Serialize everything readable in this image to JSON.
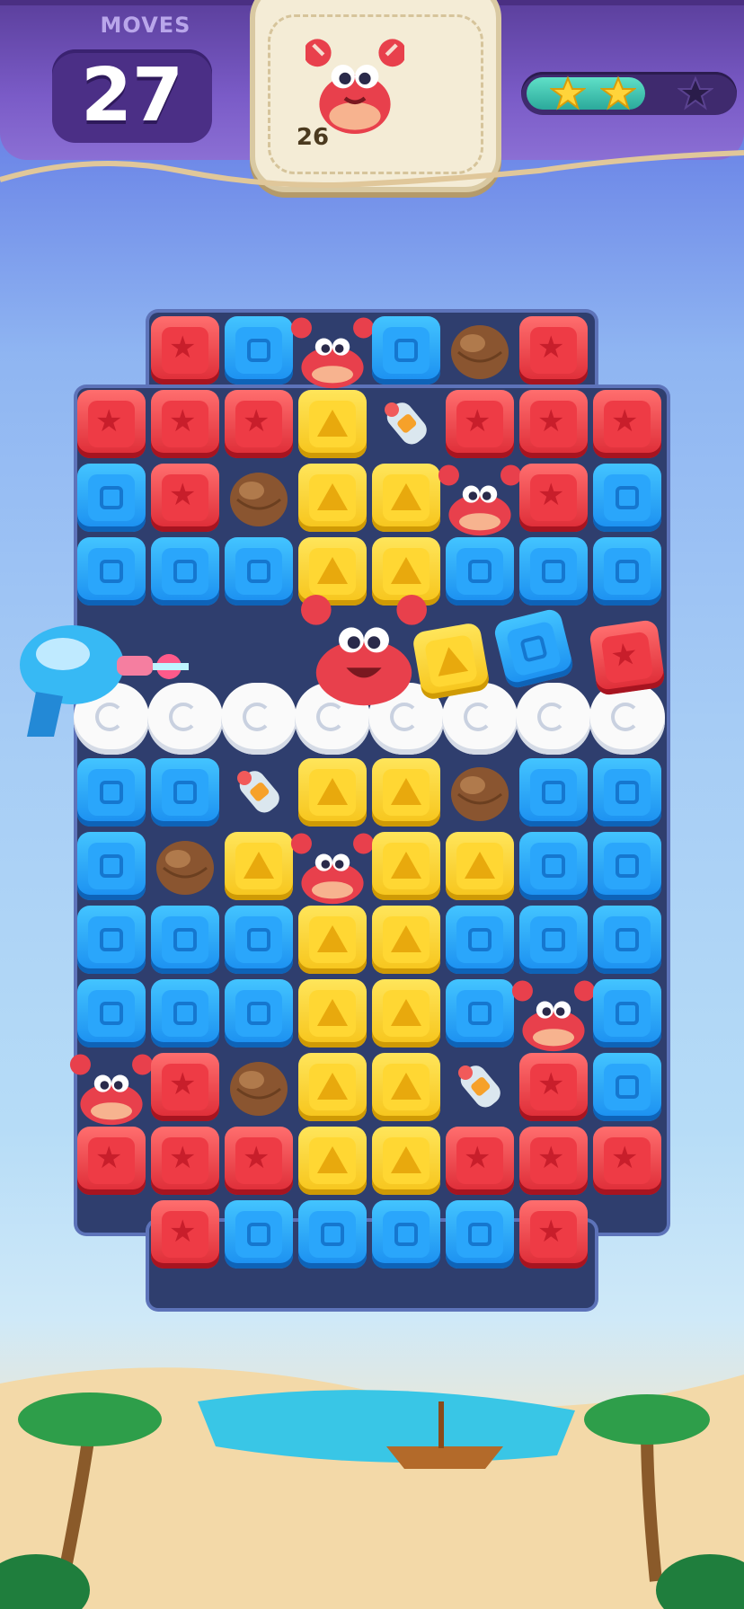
{
  "hud": {
    "moves_label": "MOVES",
    "moves_value": "27",
    "goal": {
      "icon": "crab-icon",
      "count": "26"
    },
    "stars": {
      "earned": 2,
      "total": 3,
      "progress": 0.58
    }
  },
  "board": {
    "rows": [
      "_RBCBNR_",
      "RRRYPRRR",
      "BRNYYCRB",
      "BBBYYBBB",
      "__._.___",
      "WWWWWWWW",
      "BBPYYNBB",
      "BNYCYYBB",
      "BBBYYBBB",
      "BBBYYBCB",
      "CRNYYPRB",
      "RRRYYRRR",
      "_RBBBBR_"
    ],
    "legend": {
      "R": "red-star-block",
      "B": "blue-square-block",
      "Y": "yellow-triangle-block",
      "C": "crab",
      "N": "coconut",
      "P": "rocket-bottle",
      "W": "cloud-blocker"
    }
  },
  "colors": {
    "red": "#e53340",
    "blue": "#22a0f7",
    "yellow": "#ffd52e",
    "hud_purple": "#6a4bb8",
    "star_fill": "#3cc6b2"
  },
  "booster": {
    "icon": "ray-gun-icon"
  }
}
